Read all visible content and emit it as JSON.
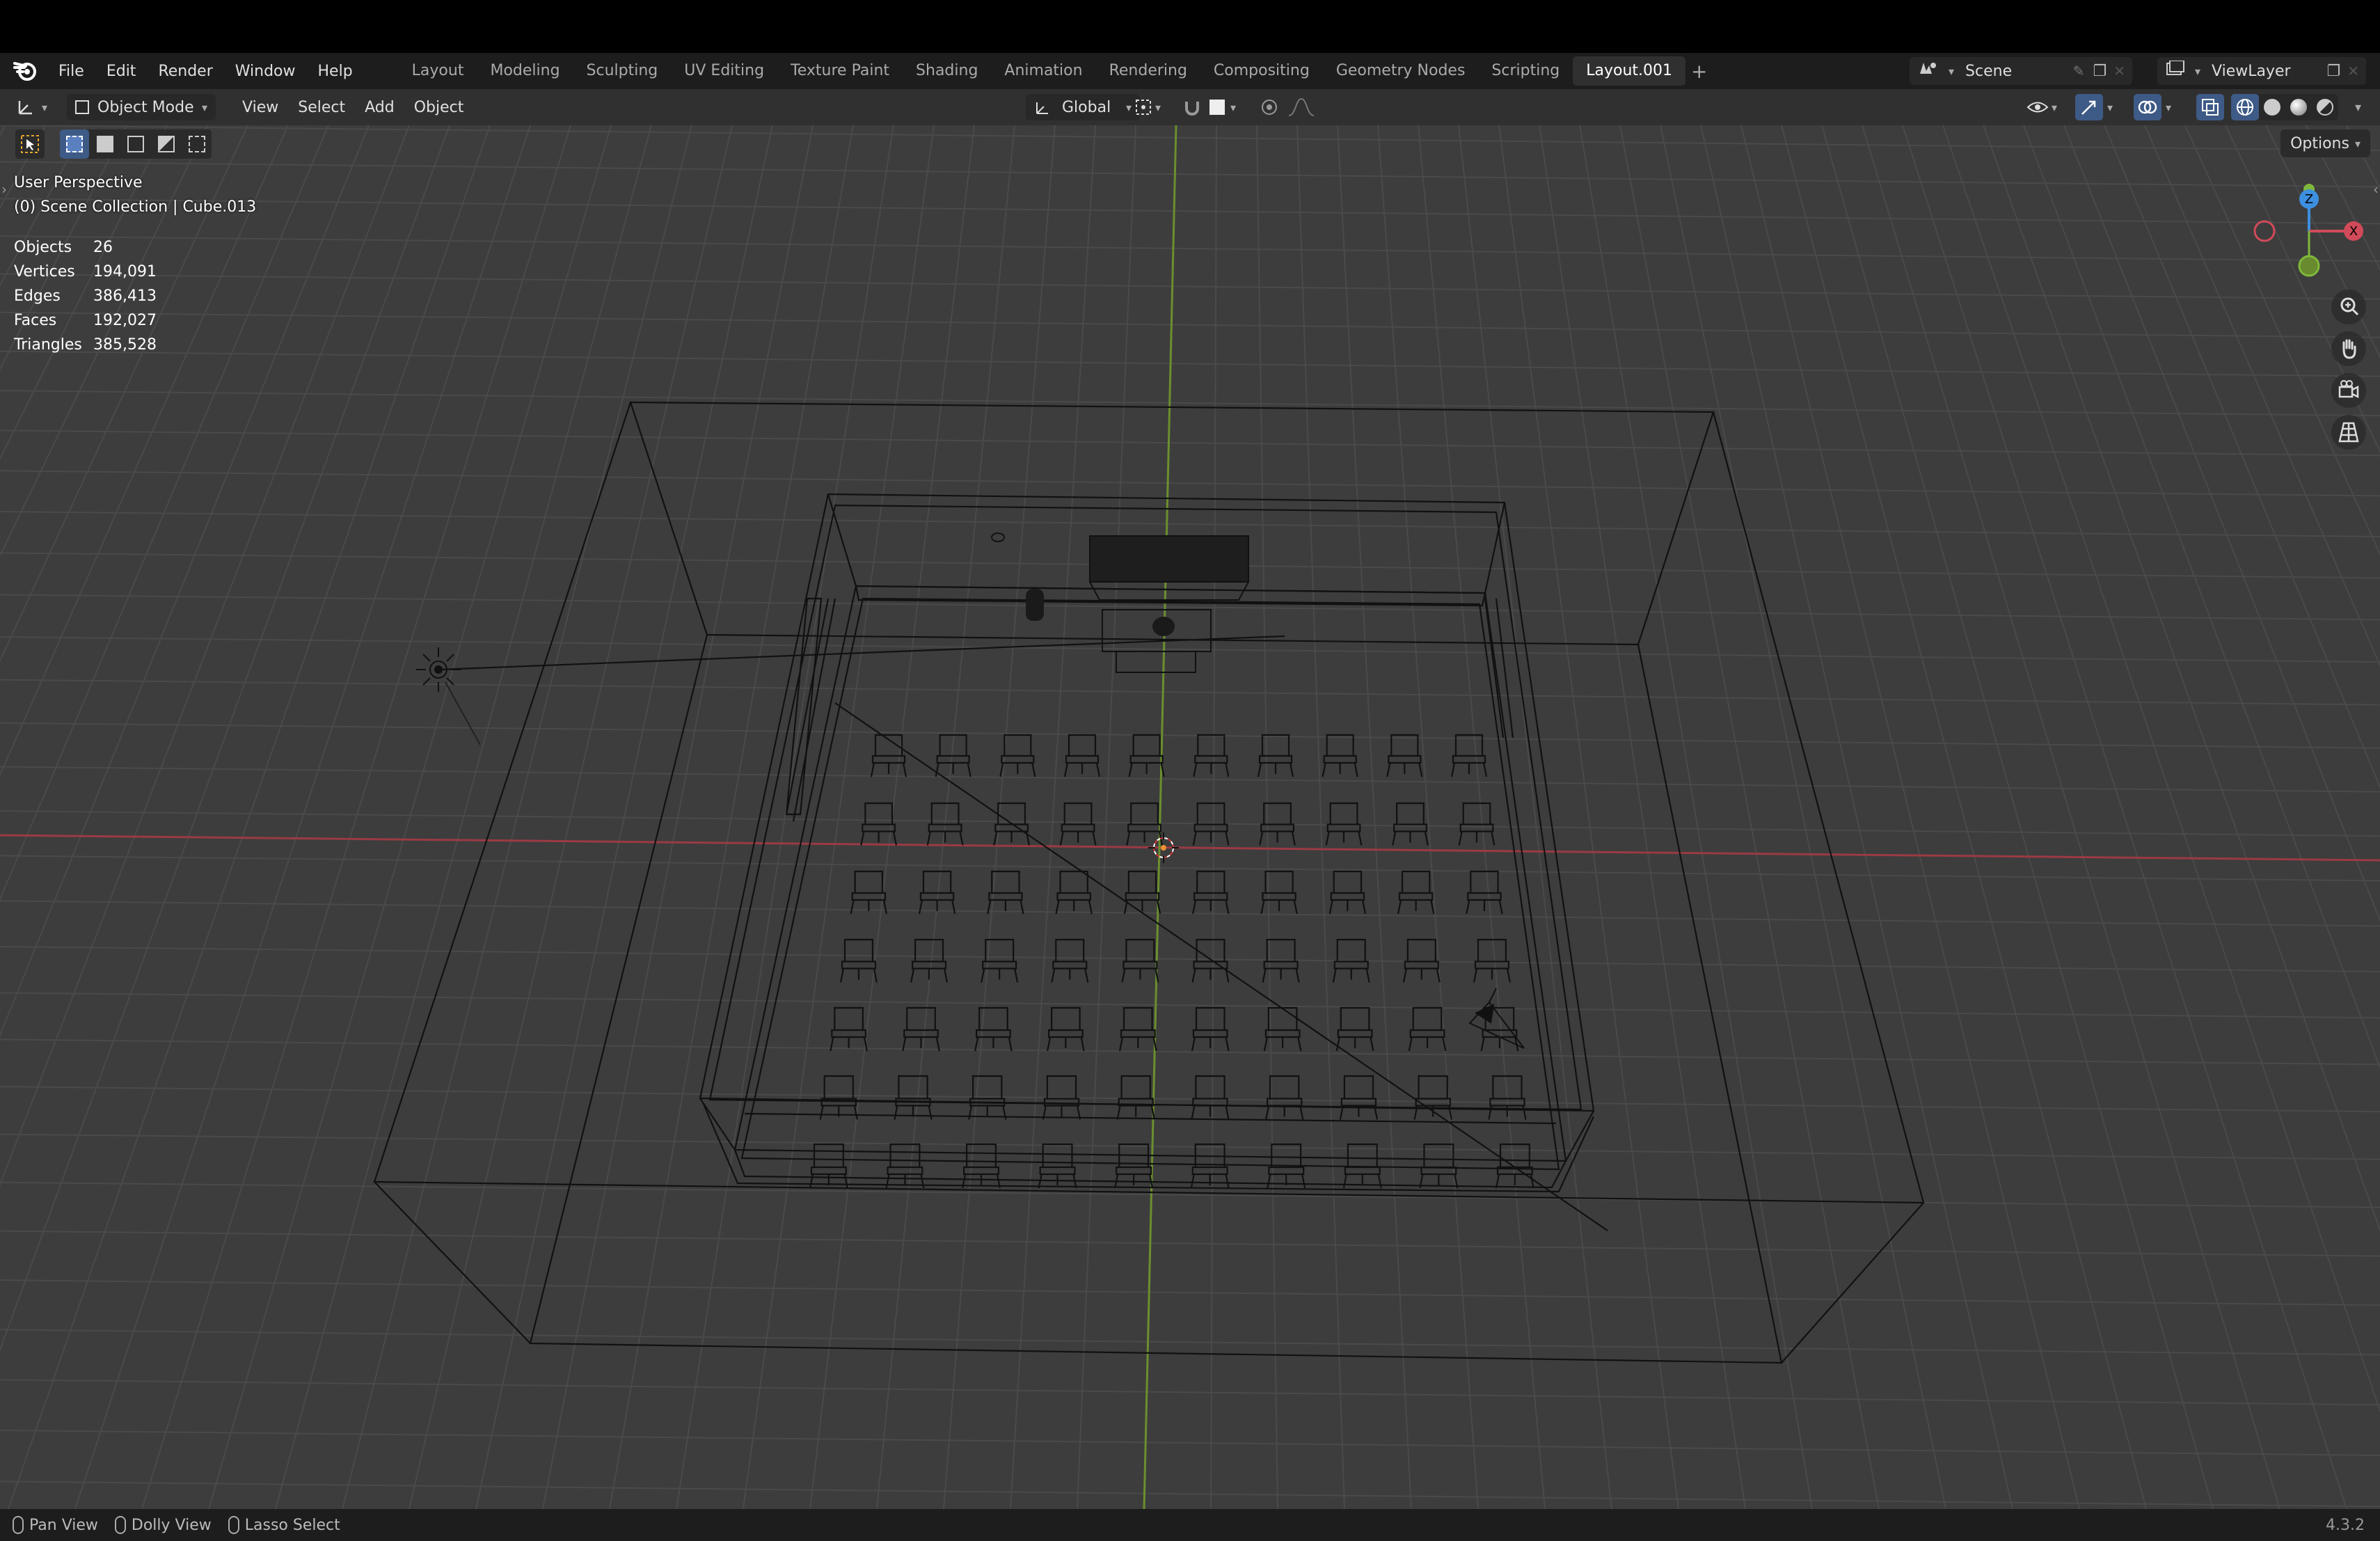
{
  "menubar": {
    "menus": [
      "File",
      "Edit",
      "Render",
      "Window",
      "Help"
    ],
    "workspaces": [
      "Layout",
      "Modeling",
      "Sculpting",
      "UV Editing",
      "Texture Paint",
      "Shading",
      "Animation",
      "Rendering",
      "Compositing",
      "Geometry Nodes",
      "Scripting",
      "Layout.001"
    ],
    "active_workspace": "Layout.001",
    "add_tab": "+",
    "scene": "Scene",
    "view_layer": "ViewLayer"
  },
  "header": {
    "mode": "Object Mode",
    "menus": [
      "View",
      "Select",
      "Add",
      "Object"
    ],
    "transform_orientation": "Global",
    "options_label": "Options"
  },
  "viewport": {
    "perspective": "User Perspective",
    "collection": "(0) Scene Collection | Cube.013",
    "stats": [
      {
        "label": "Objects",
        "value": "26"
      },
      {
        "label": "Vertices",
        "value": "194,091"
      },
      {
        "label": "Edges",
        "value": "386,413"
      },
      {
        "label": "Faces",
        "value": "192,027"
      },
      {
        "label": "Triangles",
        "value": "385,528"
      }
    ],
    "gizmo": {
      "z": "Z",
      "x": "X"
    }
  },
  "statusbar": {
    "items": [
      "Pan View",
      "Dolly View",
      "Lasso Select"
    ],
    "version": "4.3.2"
  },
  "colors": {
    "x_axis": "#d14a5a",
    "y_axis": "#7fb83a",
    "z_axis": "#3d8fe0",
    "accent": "#4772b3"
  }
}
